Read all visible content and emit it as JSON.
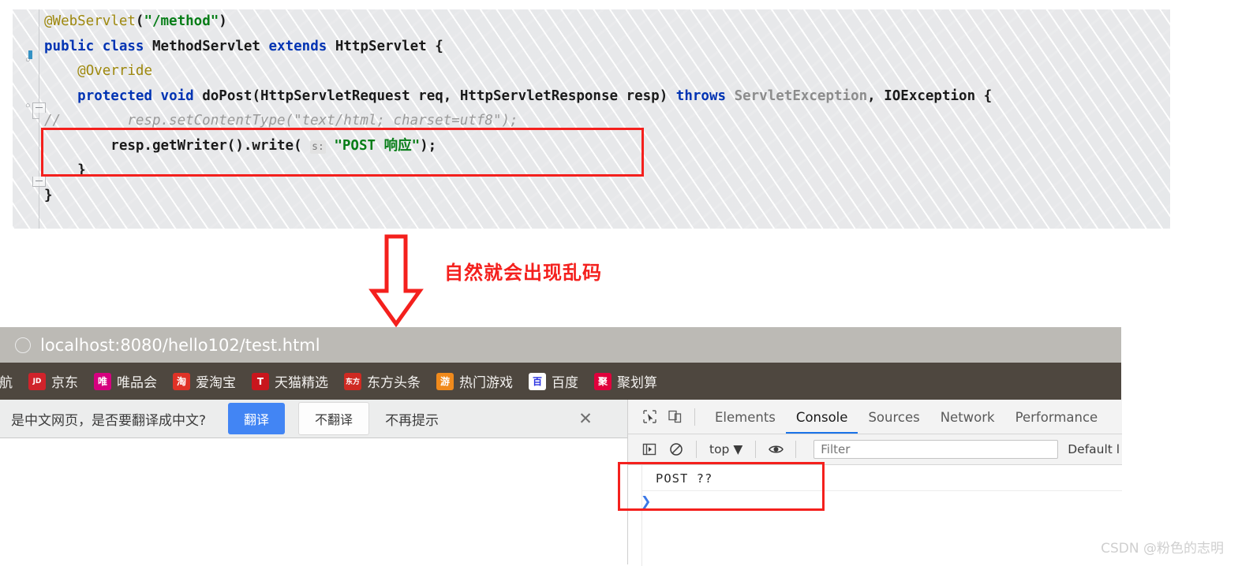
{
  "editor": {
    "lines": [
      {
        "id": "l1",
        "segments": [
          {
            "t": "@WebServlet",
            "c": "ann"
          },
          {
            "t": "(",
            "c": "pl"
          },
          {
            "t": "\"/method\"",
            "c": "str"
          },
          {
            "t": ")",
            "c": "pl"
          }
        ]
      },
      {
        "id": "l2",
        "segments": [
          {
            "t": "public",
            "c": "kw"
          },
          {
            "t": " ",
            "c": "pl"
          },
          {
            "t": "class",
            "c": "kw"
          },
          {
            "t": " ",
            "c": "pl"
          },
          {
            "t": "MethodServlet",
            "c": "cls"
          },
          {
            "t": " ",
            "c": "pl"
          },
          {
            "t": "extends",
            "c": "kw"
          },
          {
            "t": " ",
            "c": "pl"
          },
          {
            "t": "HttpServlet",
            "c": "cls"
          },
          {
            "t": " {",
            "c": "pl"
          }
        ]
      },
      {
        "id": "l3",
        "segments": [
          {
            "t": "    ",
            "c": "pl"
          },
          {
            "t": "@Override",
            "c": "ann"
          }
        ]
      },
      {
        "id": "l4",
        "segments": [
          {
            "t": "    ",
            "c": "pl"
          },
          {
            "t": "protected",
            "c": "kw"
          },
          {
            "t": " ",
            "c": "pl"
          },
          {
            "t": "void",
            "c": "kw"
          },
          {
            "t": " ",
            "c": "pl"
          },
          {
            "t": "doPost",
            "c": "cls"
          },
          {
            "t": "(HttpServletRequest req, HttpServletResponse resp) ",
            "c": "pl"
          },
          {
            "t": "throws",
            "c": "kw"
          },
          {
            "t": " ",
            "c": "pl"
          },
          {
            "t": "ServletException",
            "c": "gray"
          },
          {
            "t": ", ",
            "c": "pl"
          },
          {
            "t": "IOException",
            "c": "cls"
          },
          {
            "t": " {",
            "c": "pl"
          }
        ]
      },
      {
        "id": "l5",
        "segments": [
          {
            "t": "//        resp.setContentType(\"text/html; charset=utf8\");",
            "c": "cmt"
          }
        ]
      },
      {
        "id": "l6",
        "segments": [
          {
            "t": "        resp.getWriter().write( ",
            "c": "pl"
          },
          {
            "t": "s:",
            "c": "hint"
          },
          {
            "t": " ",
            "c": "pl"
          },
          {
            "t": "\"POST 响应\"",
            "c": "str"
          },
          {
            "t": ");",
            "c": "pl"
          }
        ]
      },
      {
        "id": "l7",
        "segments": [
          {
            "t": "    }",
            "c": "pl"
          }
        ]
      },
      {
        "id": "l8",
        "segments": [
          {
            "t": "}",
            "c": "pl"
          }
        ]
      }
    ],
    "highlight_note": "red-rectangle-around-lines-5-and-6"
  },
  "annotation": {
    "text": "自然就会出现乱码",
    "arrow_direction": "down",
    "color": "#f4201d"
  },
  "browser": {
    "url": "localhost:8080/hello102/test.html",
    "shield_icon": "page-info-icon",
    "bookmarks": [
      {
        "fav": "",
        "label": "导航",
        "bg": "transparent",
        "fg": "#ffffff",
        "icon_name": "nav-favicon"
      },
      {
        "fav": "JD",
        "label": "京东",
        "bg": "#d0232b",
        "fg": "#ffffff",
        "icon_name": "jd-favicon"
      },
      {
        "fav": "唯",
        "label": "唯品会",
        "bg": "#d6007f",
        "fg": "#ffffff",
        "icon_name": "vip-favicon"
      },
      {
        "fav": "淘",
        "label": "爱淘宝",
        "bg": "#e03227",
        "fg": "#ffffff",
        "icon_name": "taobao-favicon"
      },
      {
        "fav": "T",
        "label": "天猫精选",
        "bg": "#c8161d",
        "fg": "#ffffff",
        "icon_name": "tmall-favicon"
      },
      {
        "fav": "东方",
        "label": "东方头条",
        "bg": "#cf2a22",
        "fg": "#ffffff",
        "icon_name": "dongfang-favicon"
      },
      {
        "fav": "游",
        "label": "热门游戏",
        "bg": "#f08a1c",
        "fg": "#ffffff",
        "icon_name": "games-favicon"
      },
      {
        "fav": "百",
        "label": "百度",
        "bg": "#ffffff",
        "fg": "#2932e1",
        "icon_name": "baidu-favicon"
      },
      {
        "fav": "聚",
        "label": "聚划算",
        "bg": "#e0003c",
        "fg": "#ffffff",
        "icon_name": "juhuasuan-favicon"
      }
    ],
    "translate_bar": {
      "message": "是中文网页，是否要翻译成中文?",
      "translate_label": "翻译",
      "dont_translate_label": "不翻译",
      "never_label": "不再提示",
      "close_label": "✕"
    }
  },
  "devtools": {
    "tabs": [
      {
        "label": "Elements",
        "active": false
      },
      {
        "label": "Console",
        "active": true
      },
      {
        "label": "Sources",
        "active": false
      },
      {
        "label": "Network",
        "active": false
      },
      {
        "label": "Performance",
        "active": false
      }
    ],
    "inspect_icon": "cursor-select-icon",
    "device_icon": "device-toolbar-icon",
    "execute_icon": "sidebar-toggle-icon",
    "clear_icon": "clear-console-icon",
    "eye_icon": "live-expression-icon",
    "context": "top ▼",
    "filter_placeholder": "Filter",
    "levels": "Default l",
    "console_output": "POST ??",
    "prompt": "❯",
    "highlight_note": "red-rectangle-around-console-output"
  },
  "watermark": "CSDN @粉色的志明",
  "colors": {
    "accent_red": "#f4201d",
    "devtools_active_tab": "#1a73e8",
    "translate_button": "#4285f4",
    "bookmarks_bar": "#4e473f",
    "url_bar": "#bcbab5"
  }
}
